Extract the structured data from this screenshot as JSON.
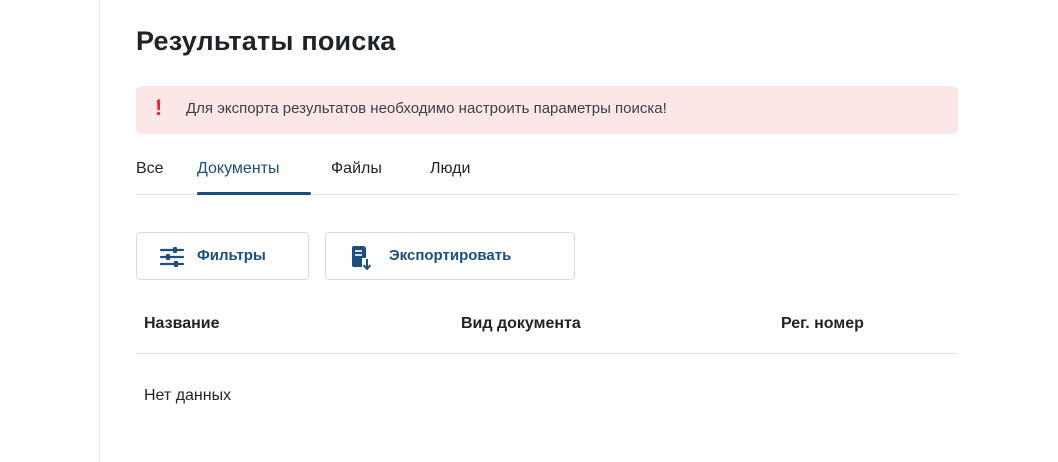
{
  "page": {
    "title": "Результаты поиска"
  },
  "alert": {
    "icon": "exclamation-icon",
    "icon_glyph": "!",
    "text": "Для экспорта результатов необходимо настроить параметры поиска!"
  },
  "tabs": [
    {
      "label": "Все",
      "active": false
    },
    {
      "label": "Документы",
      "active": true
    },
    {
      "label": "Файлы",
      "active": false
    },
    {
      "label": "Люди",
      "active": false
    }
  ],
  "toolbar": {
    "filters_label": "Фильтры",
    "filters_icon": "sliders-icon",
    "export_label": "Экспортировать",
    "export_icon": "document-export-icon"
  },
  "table": {
    "columns": [
      "Название",
      "Вид документа",
      "Рег. номер"
    ],
    "empty_text": "Нет данных"
  },
  "colors": {
    "accent": "#1c4f7c",
    "alert_background": "#fde6e6",
    "alert_icon": "#e5262f"
  }
}
